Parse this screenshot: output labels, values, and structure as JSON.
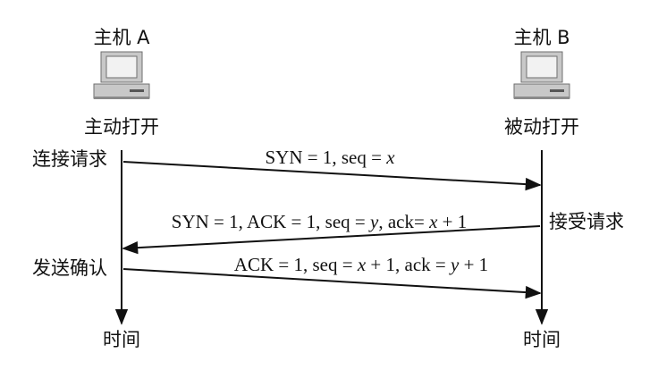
{
  "host_a": {
    "title": "主机 A",
    "role": "主动打开",
    "events": [
      "连接请求",
      "发送确认"
    ],
    "axis_label": "时间"
  },
  "host_b": {
    "title": "主机 B",
    "role": "被动打开",
    "events": [
      "接受请求"
    ],
    "axis_label": "时间"
  },
  "messages": [
    {
      "from": "A",
      "to": "B",
      "parts": [
        {
          "t": "SYN = 1, seq = ",
          "i": false
        },
        {
          "t": "x",
          "i": true
        }
      ]
    },
    {
      "from": "B",
      "to": "A",
      "parts": [
        {
          "t": "SYN = 1, ACK = 1, seq = ",
          "i": false
        },
        {
          "t": "y",
          "i": true
        },
        {
          "t": ", ack= ",
          "i": false
        },
        {
          "t": "x",
          "i": true
        },
        {
          "t": " + 1",
          "i": false
        }
      ]
    },
    {
      "from": "A",
      "to": "B",
      "parts": [
        {
          "t": "ACK = 1, seq = ",
          "i": false
        },
        {
          "t": "x",
          "i": true
        },
        {
          "t": " + 1, ack = ",
          "i": false
        },
        {
          "t": "y",
          "i": true
        },
        {
          "t": " + 1",
          "i": false
        }
      ]
    }
  ],
  "colors": {
    "ink": "#111111",
    "computer_body": "#c8c8c8",
    "computer_dark": "#8a8a8a",
    "screen": "#f2f2f2"
  },
  "icons": [
    "computer-icon",
    "computer-icon"
  ]
}
